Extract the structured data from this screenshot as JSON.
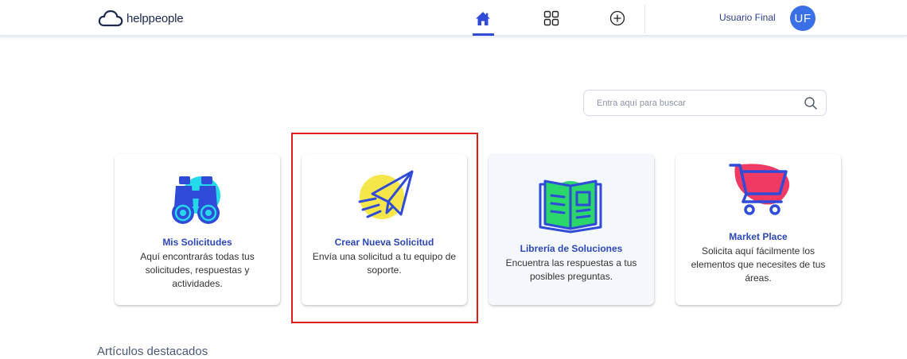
{
  "header": {
    "logo_text": "helppeople",
    "user_name": "Usuario Final",
    "avatar_initials": "UF",
    "icons": [
      "home-icon",
      "grid-icon",
      "plus-circle-icon"
    ]
  },
  "search": {
    "placeholder": "Entra aquí para buscar"
  },
  "cards": [
    {
      "title": "Mis Solicitudes",
      "description": "Aquí encontrarás todas tus solicitudes, respuestas y actividades.",
      "icon": "binoculars-icon"
    },
    {
      "title": "Crear Nueva Solicitud",
      "description": "Envía una solicitud a tu equipo de soporte.",
      "icon": "paper-plane-icon"
    },
    {
      "title": "Librería de Soluciones",
      "description": "Encuentra las respuestas a tus posibles preguntas.",
      "icon": "open-book-icon"
    },
    {
      "title": "Market Place",
      "description": "Solicita aquí fácilmente los elementos que necesites de tus áreas.",
      "icon": "shopping-cart-icon"
    }
  ],
  "section": {
    "title": "Artículos destacados"
  },
  "colors": {
    "brand_blue": "#2b47b8",
    "avatar_blue": "#3b6fe6",
    "highlight_red": "#e01b1b"
  }
}
